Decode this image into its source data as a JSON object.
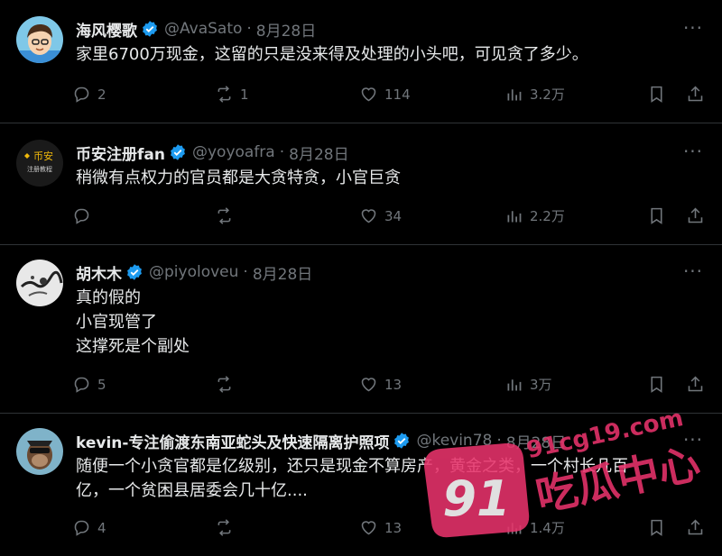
{
  "tweets": [
    {
      "name": "海风樱歌",
      "handle": "@AvaSato",
      "date": "8月28日",
      "lines": [
        "家里6700万现金，这留的只是没来得及处理的小头吧，可见贪了多少。"
      ],
      "replies": "2",
      "retweets": "1",
      "likes": "114",
      "views": "3.2万",
      "avatar_icon": "cartoon-avatar"
    },
    {
      "name": "币安注册fan",
      "handle": "@yoyoafra",
      "date": "8月28日",
      "lines": [
        "稍微有点权力的官员都是大贪特贪，小官巨贪"
      ],
      "replies": "",
      "retweets": "",
      "likes": "34",
      "views": "2.2万",
      "avatar_icon": "binance-logo-avatar",
      "avatar_text": [
        "币安",
        "注册教程"
      ]
    },
    {
      "name": "胡木木",
      "handle": "@piyoloveu",
      "date": "8月28日",
      "lines": [
        "真的假的",
        "小官现管了",
        "这撑死是个副处"
      ],
      "replies": "5",
      "retweets": "",
      "likes": "13",
      "views": "3万",
      "avatar_icon": "ink-painting-avatar"
    },
    {
      "name": "kevin-专注偷渡东南亚蛇头及快速隔离护照项",
      "handle": "@kevin78",
      "date": "8月28日",
      "lines": [
        "随便一个小贪官都是亿级别，还只是现金不算房产，黄金之类，一个村长几百",
        "亿，一个贫困县居委会几十亿...."
      ],
      "replies": "4",
      "retweets": "",
      "likes": "13",
      "views": "1.4万",
      "avatar_icon": "ape-avatar"
    }
  ],
  "watermark": {
    "number": "91",
    "site": "91cg19.com",
    "text": "吃瓜中心",
    "color": "#e8336b"
  },
  "colors": {
    "background": "#000000",
    "text": "#e7e9ea",
    "muted": "#71767b",
    "verified": "#1d9bf0",
    "divider": "#2f3336"
  }
}
